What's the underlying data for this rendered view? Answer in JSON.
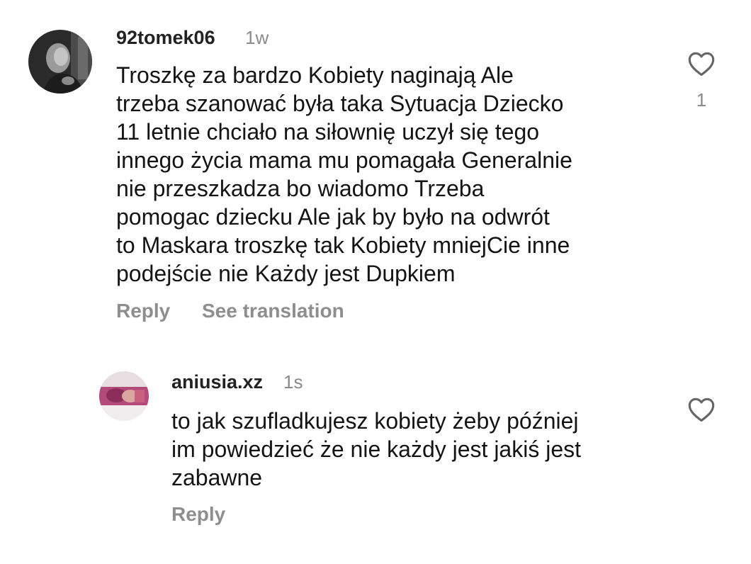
{
  "comments": [
    {
      "username": "92tomek06",
      "time": "1w",
      "avatar_icon": "user-photo-avatar",
      "text": "Troszkę za bardzo Kobiety naginają Ale\ntrzeba szanować była taka Sytuacja Dziecko\n11 letnie chciało na siłownię uczył się tego\ninnego życia mama mu pomagała Generalnie\nnie przeszkadza bo wiadomo Trzeba\npomogac dziecku Ale jak by było na odwrót\nto Maskara troszkę tak Kobiety mniejCie inne\npodejście nie Każdy jest Dupkiem",
      "reply_label": "Reply",
      "translate_label": "See translation",
      "like_icon": "heart-outline-icon",
      "like_count": "1"
    },
    {
      "username": "aniusia.xz",
      "time": "1s",
      "avatar_icon": "user-photo-avatar",
      "text": "to jak szufladkujesz kobiety żeby później\nim powiedzieć że nie każdy jest jakiś jest\nzabawne",
      "reply_label": "Reply",
      "like_icon": "heart-outline-icon"
    }
  ],
  "colors": {
    "background": "#ffffff",
    "text": "#141414",
    "muted": "#8e8e8e",
    "icon": "#666666"
  }
}
